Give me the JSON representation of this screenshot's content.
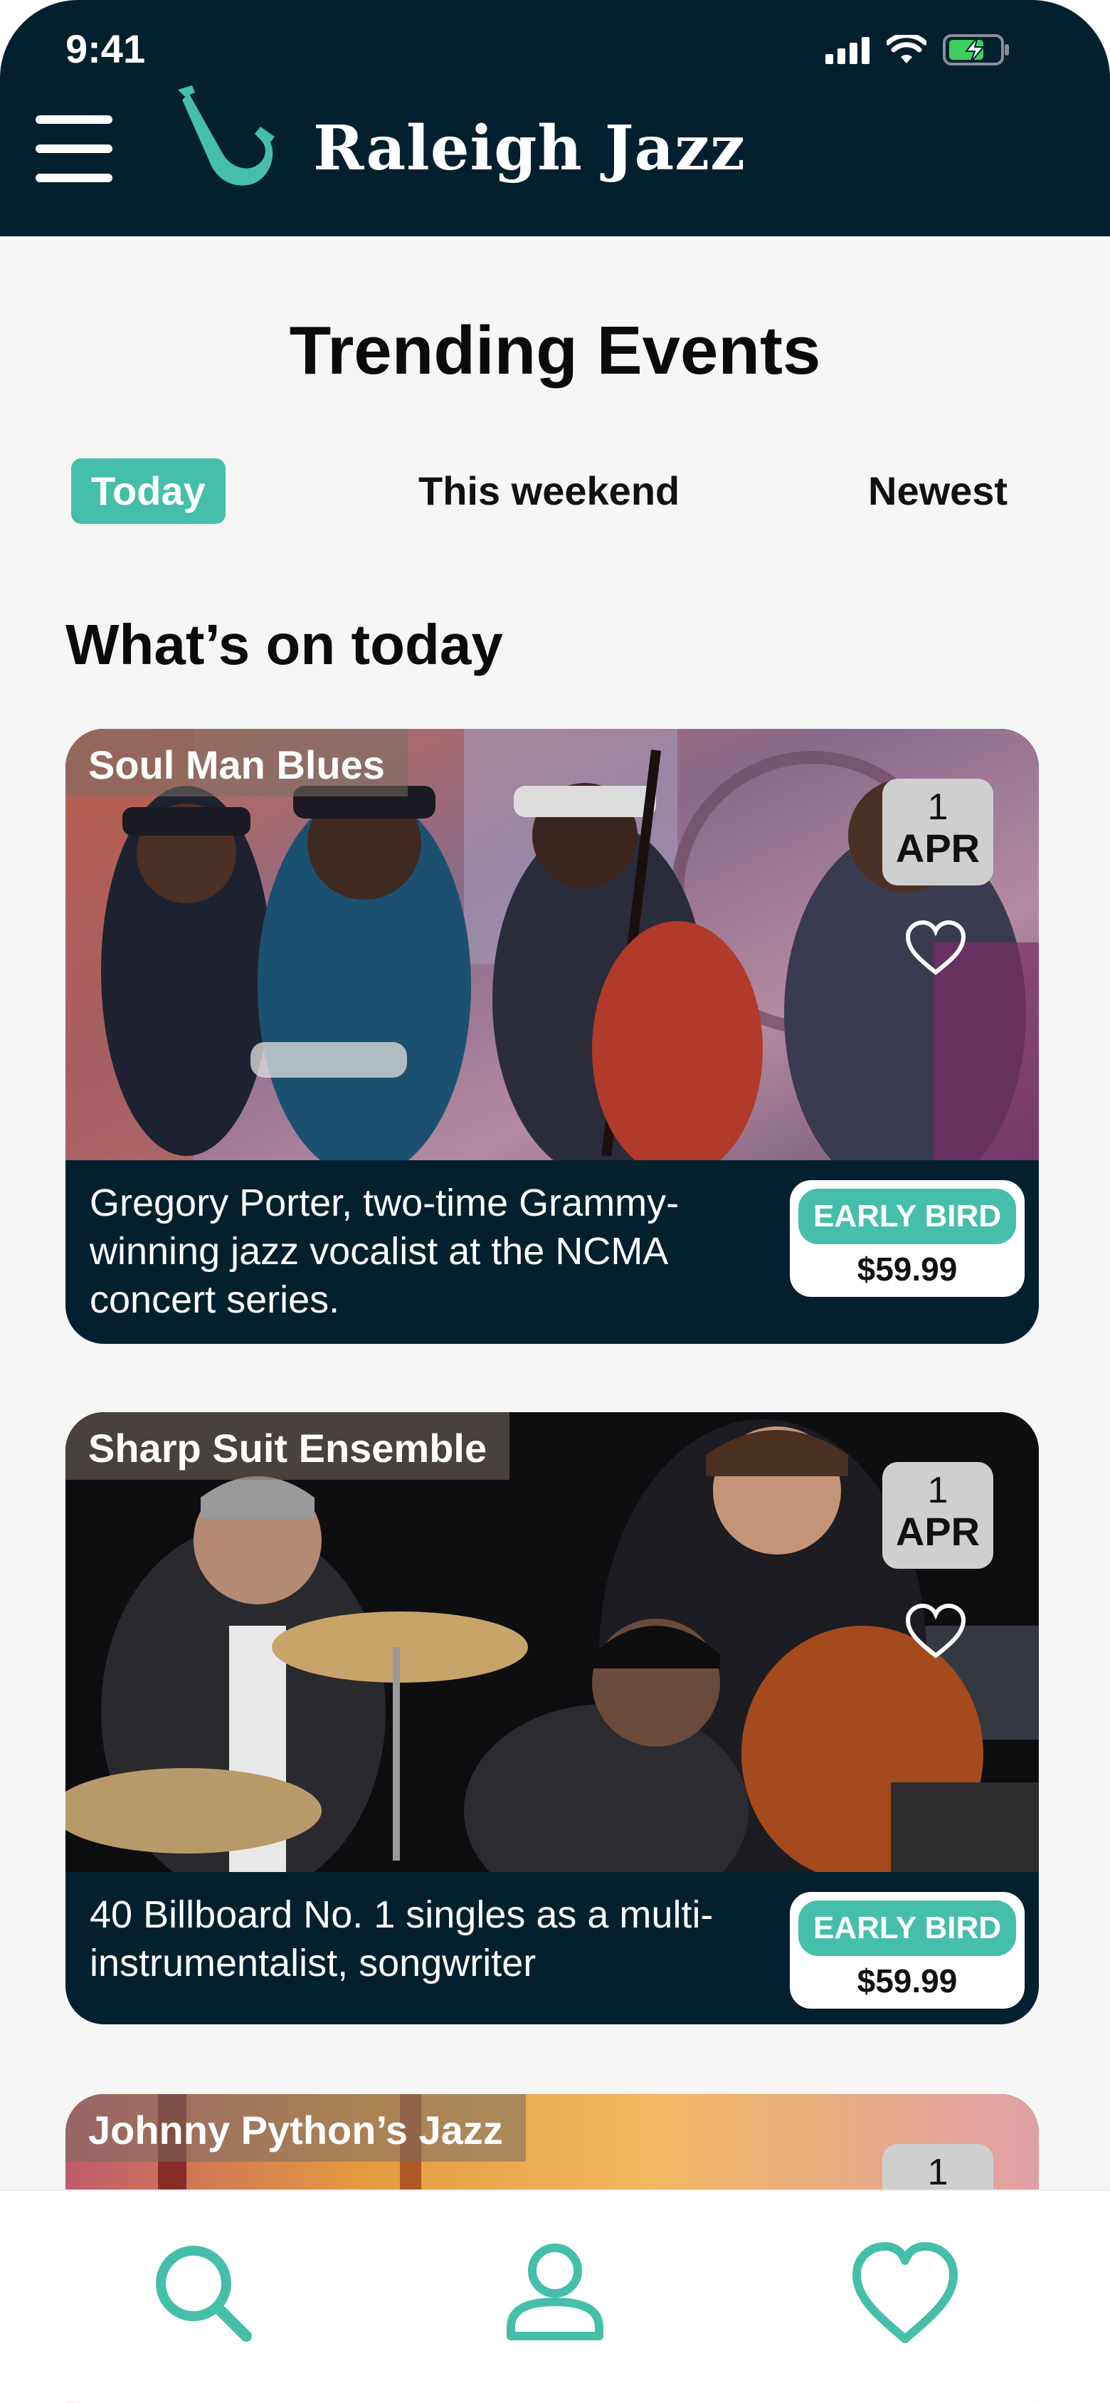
{
  "status_bar": {
    "time": "9:41"
  },
  "header": {
    "brand": "Raleigh Jazz"
  },
  "page": {
    "title": "Trending Events",
    "tabs": [
      {
        "label": "Today",
        "active": true
      },
      {
        "label": "This weekend",
        "active": false
      },
      {
        "label": "Newest",
        "active": false
      }
    ],
    "section_title": "What’s on today"
  },
  "events": [
    {
      "title": "Soul Man Blues",
      "day": "1",
      "month": "APR",
      "description": "Gregory Porter, two-time Grammy-winning jazz vocalist at the NCMA concert series.",
      "badge": "EARLY BIRD",
      "price": "$59.99"
    },
    {
      "title": "Sharp Suit Ensemble",
      "day": "1",
      "month": "APR",
      "description": "40 Billboard No. 1 singles as a multi-instrumentalist, songwriter",
      "badge": "EARLY BIRD",
      "price": "$59.99"
    },
    {
      "title": "Johnny Python’s Jazz",
      "day": "1"
    }
  ],
  "bottom_nav": {
    "items": [
      {
        "icon": "search-icon"
      },
      {
        "icon": "profile-icon"
      },
      {
        "icon": "favorites-icon"
      }
    ]
  },
  "colors": {
    "header_bg": "#03202f",
    "accent": "#45bfa9",
    "page_bg": "#f6f6f6"
  }
}
